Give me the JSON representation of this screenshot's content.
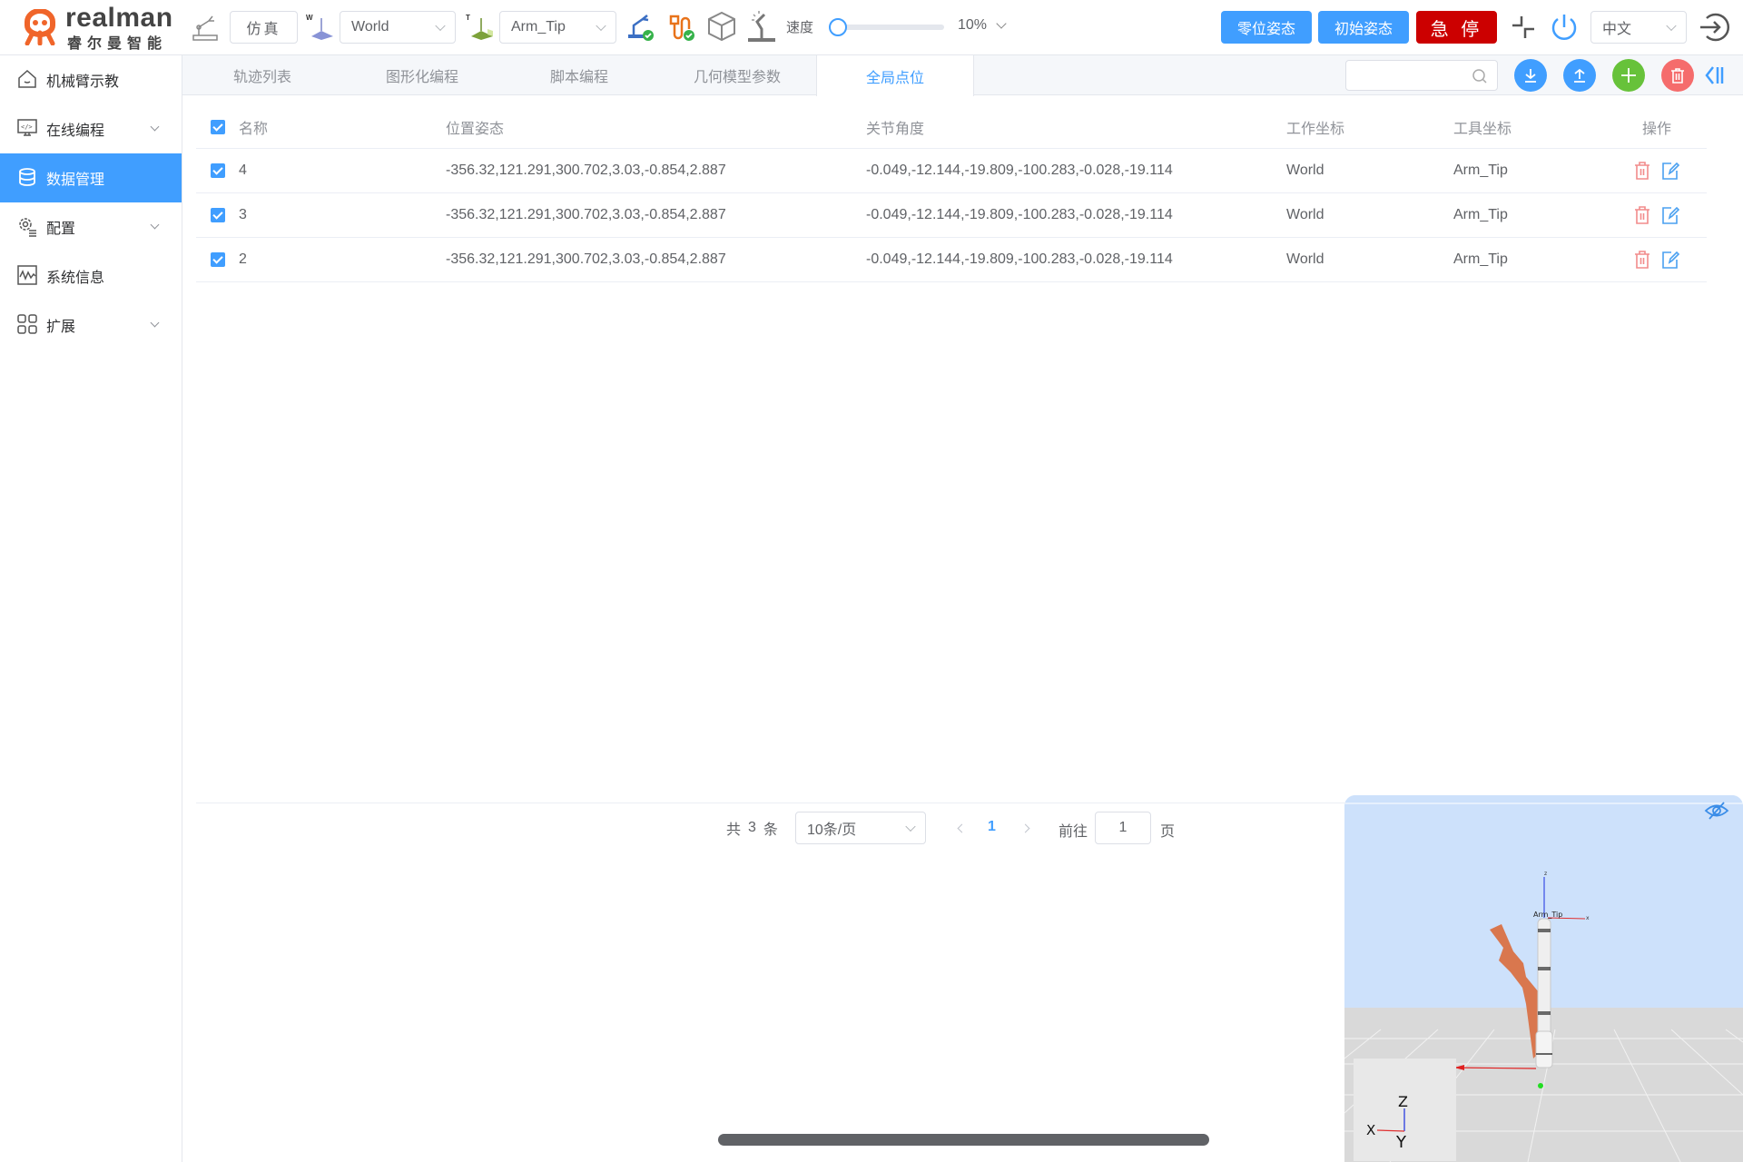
{
  "header": {
    "logo": {
      "brand": "realman",
      "subtitle": "睿尔曼智能",
      "brand_color": "#f0652a"
    },
    "mode_button": "仿真",
    "work_frame": {
      "prefix": "W",
      "value": "World"
    },
    "tool_frame": {
      "prefix": "T",
      "value": "Arm_Tip"
    },
    "speed": {
      "label": "速度",
      "value_percent": 10,
      "value_label": "10%"
    },
    "zero_pose_button": "零位姿态",
    "init_pose_button": "初始姿态",
    "estop_button": "急 停",
    "language": "中文",
    "colors": {
      "primary": "#409eff",
      "danger": "#cc0000"
    }
  },
  "sidebar": {
    "active_color": "#409eff",
    "items": [
      {
        "label": "机械臂示教",
        "icon": "home-icon",
        "expandable": false,
        "active": false
      },
      {
        "label": "在线编程",
        "icon": "code-monitor-icon",
        "expandable": true,
        "active": false
      },
      {
        "label": "数据管理",
        "icon": "database-icon",
        "expandable": false,
        "active": true
      },
      {
        "label": "配置",
        "icon": "gear-list-icon",
        "expandable": true,
        "active": false
      },
      {
        "label": "系统信息",
        "icon": "pulse-monitor-icon",
        "expandable": false,
        "active": false
      },
      {
        "label": "扩展",
        "icon": "grid-icon",
        "expandable": true,
        "active": false
      }
    ]
  },
  "tabs": [
    {
      "label": "轨迹列表",
      "active": false
    },
    {
      "label": "图形化编程",
      "active": false
    },
    {
      "label": "脚本编程",
      "active": false
    },
    {
      "label": "几何模型参数",
      "active": false
    },
    {
      "label": "全局点位",
      "active": true
    }
  ],
  "search": {
    "value": "",
    "placeholder": ""
  },
  "table": {
    "columns": [
      "名称",
      "位置姿态",
      "关节角度",
      "工作坐标",
      "工具坐标",
      "操作"
    ],
    "rows": [
      {
        "checked": true,
        "name": "4",
        "pose": "-356.32,121.291,300.702,3.03,-0.854,2.887",
        "joints": "-0.049,-12.144,-19.809,-100.283,-0.028,-19.114",
        "work": "World",
        "tool": "Arm_Tip"
      },
      {
        "checked": true,
        "name": "3",
        "pose": "-356.32,121.291,300.702,3.03,-0.854,2.887",
        "joints": "-0.049,-12.144,-19.809,-100.283,-0.028,-19.114",
        "work": "World",
        "tool": "Arm_Tip"
      },
      {
        "checked": true,
        "name": "2",
        "pose": "-356.32,121.291,300.702,3.03,-0.854,2.887",
        "joints": "-0.049,-12.144,-19.809,-100.283,-0.028,-19.114",
        "work": "World",
        "tool": "Arm_Tip"
      }
    ]
  },
  "pagination": {
    "total_prefix": "共",
    "total": "3",
    "total_suffix": "条",
    "page_size": "10条/页",
    "current_page": "1",
    "goto_label": "前往",
    "goto_value": "1",
    "goto_suffix": "页"
  },
  "viewer": {
    "frame_label": "Arm_Tip",
    "axis_labels": {
      "x": "X",
      "y": "Y",
      "z": "Z",
      "small_z": "z",
      "small_x": "x"
    }
  }
}
